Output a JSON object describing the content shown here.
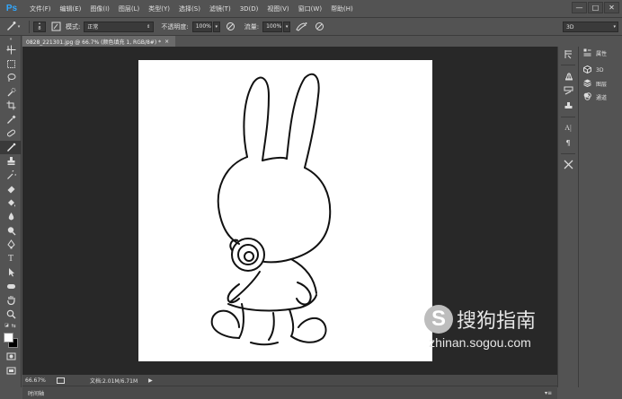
{
  "app": {
    "logo": "Ps",
    "window_controls": [
      "—",
      "□",
      "✕"
    ]
  },
  "menu": [
    "文件(F)",
    "编辑(E)",
    "图像(I)",
    "图层(L)",
    "类型(Y)",
    "选择(S)",
    "滤镜(T)",
    "3D(D)",
    "视图(V)",
    "窗口(W)",
    "帮助(H)"
  ],
  "options": {
    "brush_size": "8",
    "mode_label": "模式:",
    "mode_value": "正常",
    "opacity_label": "不透明度:",
    "opacity_value": "100%",
    "flow_label": "流量:",
    "flow_value": "100%",
    "workspace": "3D"
  },
  "document": {
    "tab_title": "0828_221301.jpg @ 66.7% (颜色填充 1, RGB/8#) *",
    "tab_close": "×"
  },
  "status": {
    "zoom": "66.67%",
    "doc_info": "文档:2.01M/6.71M",
    "arrow": "▶"
  },
  "timeline": {
    "label": "时间轴",
    "menu_icon": "▾≡"
  },
  "panels": {
    "properties": "属性",
    "three_d": "3D",
    "layers": "图层",
    "channels": "通道"
  },
  "watermark": {
    "logo_letter": "S",
    "text": "搜狗指南",
    "url": "zhinan.sogou.com"
  },
  "colors": {
    "app_bg": "#535353",
    "canvas_bg": "#282828",
    "ps_blue": "#31a8ff"
  }
}
